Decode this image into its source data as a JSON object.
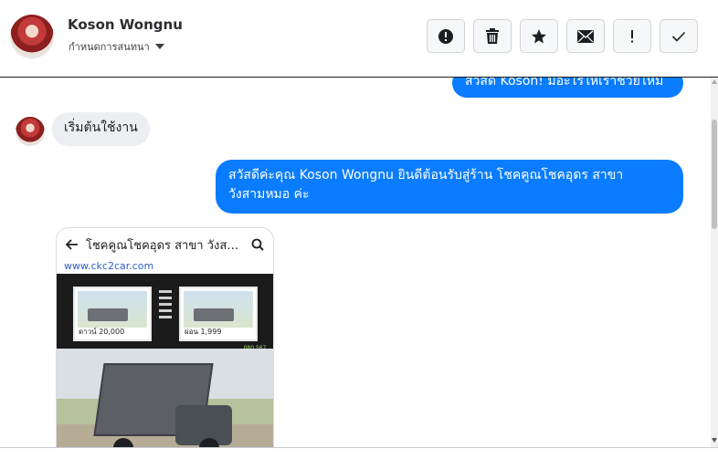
{
  "contact": {
    "name": "Koson Wongnu",
    "assign_label": "กำหนดการสนทนา"
  },
  "toolbar": {
    "buttons": [
      {
        "icon": "alert-circle-icon",
        "label": "!"
      },
      {
        "icon": "trash-icon"
      },
      {
        "icon": "star-icon"
      },
      {
        "icon": "envelope-icon"
      },
      {
        "icon": "exclamation-icon",
        "label": "!"
      },
      {
        "icon": "checkmark-icon"
      }
    ]
  },
  "messages": [
    {
      "direction": "outgoing",
      "text": "สวัสดี Koson! มีอะไรให้เราช่วยไหม"
    },
    {
      "direction": "incoming",
      "text": "เริ่มต้นใช้งาน"
    },
    {
      "direction": "outgoing",
      "text": "สวัสดีค่ะคุณ Koson Wongnu ยินดีต้อนรับสู่ร้าน โชคคูณโชคอุดร สาขา วังสามหมอ ค่ะ"
    }
  ],
  "shared_card": {
    "title": "โชคคูณโชคอุดร สาขา วังสาม...",
    "url": "www.ckc2car.com",
    "price_left": "ดาวน์ 20,000",
    "price_right": "ผ่อน 1,999",
    "logo_text": "080 567 7083"
  },
  "colors": {
    "accent": "#0a7cff",
    "incoming_bubble": "#eceef1",
    "header_border": "#1c1e21"
  }
}
